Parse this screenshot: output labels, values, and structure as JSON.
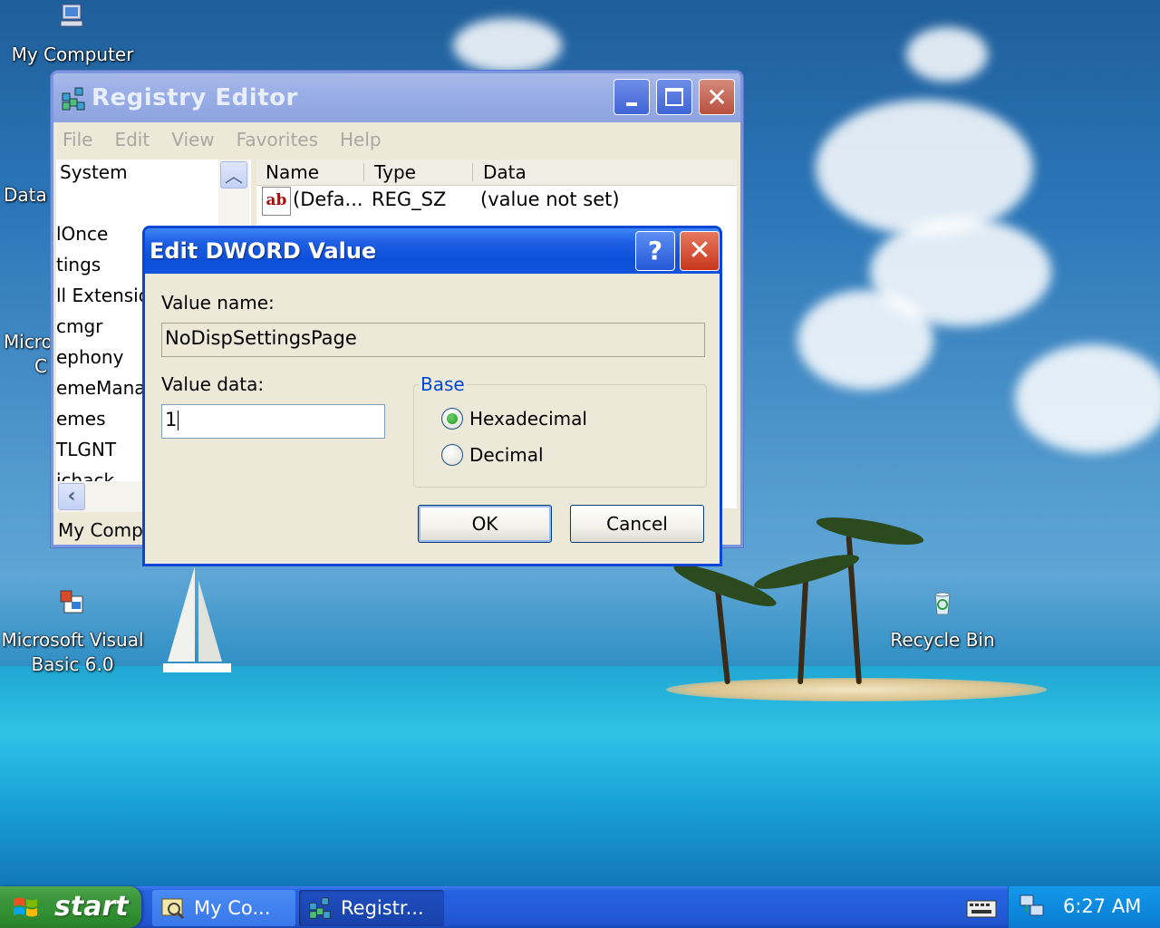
{
  "desktop": {
    "icons": {
      "my_computer": "My Computer",
      "data": "Data",
      "micro": "Micro",
      "micro_2": "C",
      "vb6_line1": "Microsoft Visual",
      "vb6_line2": "Basic 6.0",
      "recycle_bin": "Recycle Bin"
    }
  },
  "registry_editor": {
    "title": "Registry Editor",
    "menu": [
      "File",
      "Edit",
      "View",
      "Favorites",
      "Help"
    ],
    "tree_nodes": [
      "System",
      "",
      "lOnce",
      "tings",
      "ll Extensio",
      "cmgr",
      "ephony",
      "emeManag",
      "emes",
      "TLGNT",
      "ichack"
    ],
    "columns": {
      "name": "Name",
      "type": "Type",
      "data": "Data"
    },
    "rows": [
      {
        "name": "(Defa...",
        "type": "REG_SZ",
        "data": "(value not set)"
      }
    ],
    "status": "My Compu"
  },
  "dialog": {
    "title": "Edit DWORD Value",
    "help_label": "?",
    "close_label": "✕",
    "value_name_label": "Value name:",
    "value_name": "NoDispSettingsPage",
    "value_data_label": "Value data:",
    "value_data": "1",
    "base_label": "Base",
    "hex_label": "Hexadecimal",
    "dec_label": "Decimal",
    "selected_base": "Hexadecimal",
    "ok_label": "OK",
    "cancel_label": "Cancel"
  },
  "taskbar": {
    "start_label": "start",
    "items": [
      {
        "label": "My Co..."
      },
      {
        "label": "Registr..."
      }
    ],
    "clock": "6:27 AM"
  },
  "colors": {
    "xp_blue": "#0c4fd9",
    "start_green": "#308e30",
    "tray_blue": "#0d8ae0"
  }
}
